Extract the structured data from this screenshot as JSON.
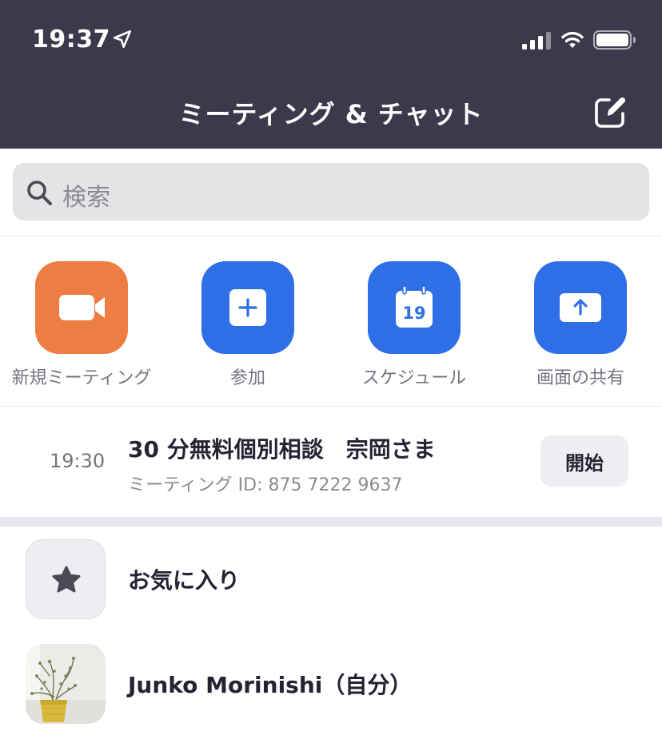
{
  "status_bar": {
    "time": "19:37"
  },
  "header": {
    "title": "ミーティング & チャット"
  },
  "search": {
    "placeholder": "検索"
  },
  "actions": [
    {
      "label": "新規ミーティング",
      "icon": "video-camera-icon",
      "color": "#ee7d43"
    },
    {
      "label": "参加",
      "icon": "plus-icon",
      "color": "#2e6ee6"
    },
    {
      "label": "スケジュール",
      "icon": "calendar-icon",
      "day": "19",
      "color": "#2e6ee6"
    },
    {
      "label": "画面の共有",
      "icon": "share-screen-icon",
      "color": "#2e6ee6"
    }
  ],
  "meeting": {
    "time": "19:30",
    "title": "30 分無料個別相談　宗岡さま",
    "id_text": "ミーティング ID: 875 7222 9637",
    "start_label": "開始"
  },
  "contacts": {
    "favorites_label": "お気に入り",
    "self_label": "Junko Morinishi（自分）"
  },
  "colors": {
    "header_bg": "#3a3a4c",
    "accent_blue": "#2e6ee6",
    "accent_orange": "#ee7d43"
  }
}
